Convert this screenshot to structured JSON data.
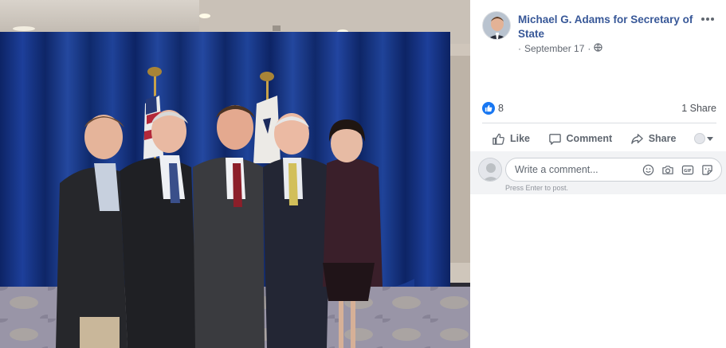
{
  "post": {
    "author": "Michael G. Adams for Secretary of State",
    "date": "September 17",
    "separator": "·",
    "privacy_icon": "globe-icon",
    "more_icon": "ellipsis-icon"
  },
  "reactions": {
    "like_count": "8",
    "shares": "1 Share"
  },
  "actions": {
    "like": "Like",
    "comment": "Comment",
    "share": "Share"
  },
  "comment_box": {
    "placeholder": "Write a comment...",
    "hint": "Press Enter to post.",
    "icons": [
      "emoji-icon",
      "camera-icon",
      "gif-icon",
      "sticker-icon"
    ]
  },
  "colors": {
    "link": "#385898",
    "reaction_blue": "#1877f2",
    "muted": "#606770",
    "curtain": "#14317a"
  }
}
